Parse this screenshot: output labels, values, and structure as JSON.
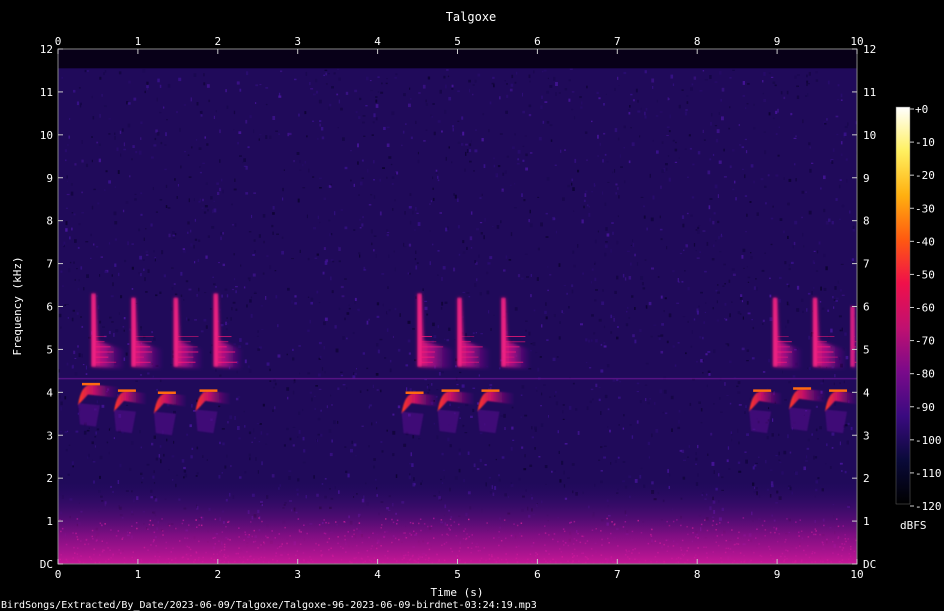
{
  "chart_data": {
    "type": "heatmap",
    "title": "Talgoxe",
    "xlabel": "Time (s)",
    "ylabel": "Frequency (kHz)",
    "xlim": [
      0,
      10
    ],
    "ylim": [
      0,
      12
    ],
    "x_ticks": [
      "0",
      "1",
      "2",
      "3",
      "4",
      "5",
      "6",
      "7",
      "8",
      "9",
      "10"
    ],
    "y_ticks": [
      "DC",
      "1",
      "2",
      "3",
      "4",
      "5",
      "6",
      "7",
      "8",
      "9",
      "10",
      "11",
      "12"
    ],
    "colorbar": {
      "unit": "dBFS",
      "range": [
        -120,
        0
      ],
      "ticks": [
        "+0",
        "-10",
        "-20",
        "-30",
        "-40",
        "-50",
        "-60",
        "-70",
        "-80",
        "-90",
        "-100",
        "-110",
        "-120"
      ],
      "colors": [
        "#000000",
        "#0a0a3a",
        "#3a0a80",
        "#7a0a8a",
        "#c01070",
        "#f0104a",
        "#ff5a10",
        "#ffb010",
        "#fff060",
        "#ffffff"
      ]
    },
    "background_color": "#200a5a",
    "calls": [
      {
        "t_start": 0.42,
        "t_end": 0.82,
        "f_low": 4.6,
        "f_high": 6.3,
        "level_db": -55
      },
      {
        "t_start": 0.92,
        "t_end": 1.3,
        "f_low": 4.6,
        "f_high": 6.2,
        "level_db": -58
      },
      {
        "t_start": 1.45,
        "t_end": 1.8,
        "f_low": 4.6,
        "f_high": 6.2,
        "level_db": -60
      },
      {
        "t_start": 1.95,
        "t_end": 2.3,
        "f_low": 4.6,
        "f_high": 6.3,
        "level_db": -62
      },
      {
        "t_start": 4.5,
        "t_end": 4.95,
        "f_low": 4.6,
        "f_high": 6.3,
        "level_db": -56
      },
      {
        "t_start": 5.0,
        "t_end": 5.4,
        "f_low": 4.6,
        "f_high": 6.2,
        "level_db": -55
      },
      {
        "t_start": 5.55,
        "t_end": 5.9,
        "f_low": 4.6,
        "f_high": 6.2,
        "level_db": -62
      },
      {
        "t_start": 8.95,
        "t_end": 9.3,
        "f_low": 4.6,
        "f_high": 6.2,
        "level_db": -55
      },
      {
        "t_start": 9.45,
        "t_end": 9.85,
        "f_low": 4.6,
        "f_high": 6.2,
        "level_db": -56
      },
      {
        "t_start": 9.92,
        "t_end": 10.0,
        "f_low": 4.6,
        "f_high": 6.0,
        "level_db": -60
      }
    ],
    "low_notes": [
      {
        "t_start": 0.25,
        "t_end": 0.75,
        "f": 4.15,
        "level_db": -50
      },
      {
        "t_start": 0.7,
        "t_end": 1.1,
        "f": 4.0,
        "level_db": -45
      },
      {
        "t_start": 1.2,
        "t_end": 1.6,
        "f": 3.95,
        "level_db": -52
      },
      {
        "t_start": 1.72,
        "t_end": 2.15,
        "f": 4.0,
        "level_db": -50
      },
      {
        "t_start": 4.3,
        "t_end": 4.75,
        "f": 3.95,
        "level_db": -50
      },
      {
        "t_start": 4.75,
        "t_end": 5.2,
        "f": 4.0,
        "level_db": -46
      },
      {
        "t_start": 5.25,
        "t_end": 5.7,
        "f": 4.0,
        "level_db": -48
      },
      {
        "t_start": 8.65,
        "t_end": 9.05,
        "f": 4.0,
        "level_db": -52
      },
      {
        "t_start": 9.15,
        "t_end": 9.6,
        "f": 4.05,
        "level_db": -48
      },
      {
        "t_start": 9.6,
        "t_end": 10.0,
        "f": 4.0,
        "level_db": -50
      }
    ],
    "noise_band": {
      "f_low": 0,
      "f_high": 1.0,
      "level_db": -75
    }
  },
  "filename": "BirdSongs/Extracted/By_Date/2023-06-09/Talgoxe/Talgoxe-96-2023-06-09-birdnet-03:24:19.mp3"
}
